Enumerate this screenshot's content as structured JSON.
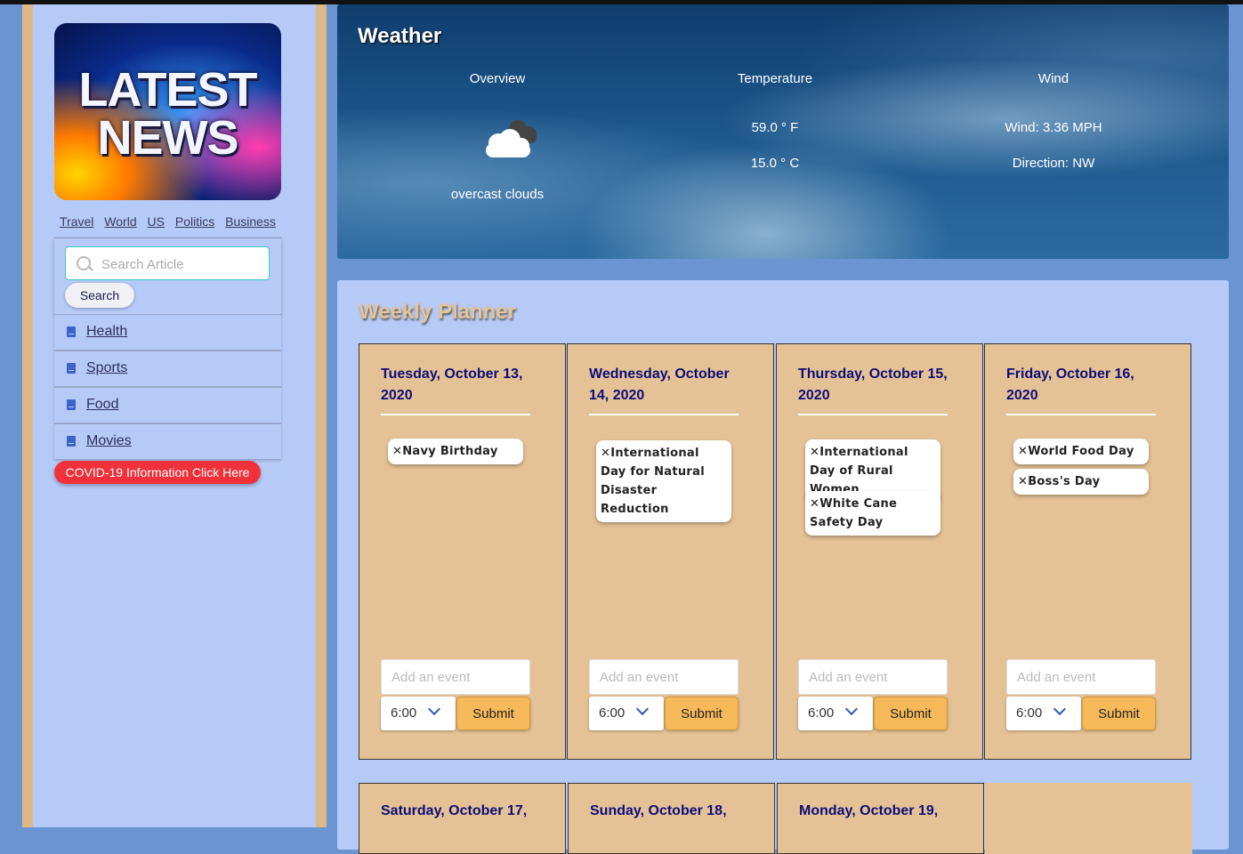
{
  "sidebar": {
    "logo_line1": "LATEST",
    "logo_line2": "NEWS",
    "nav": [
      "Travel",
      "World",
      "US",
      "Politics",
      "Business"
    ],
    "search": {
      "placeholder": "Search Article",
      "button": "Search"
    },
    "categories": [
      "Health",
      "Sports",
      "Food",
      "Movies"
    ],
    "covid_button": "COVID-19 Information Click Here"
  },
  "weather": {
    "title": "Weather",
    "overview_heading": "Overview",
    "icon": "overcast-cloud-icon",
    "description": "overcast clouds",
    "temperature_heading": "Temperature",
    "temp_f": "59.0 ° F",
    "temp_c": "15.0 ° C",
    "wind_heading": "Wind",
    "wind_speed": "Wind: 3.36 MPH",
    "wind_direction": "Direction: NW"
  },
  "planner": {
    "title": "Weekly Planner",
    "add_placeholder": "Add an event",
    "time_value": "6:00",
    "submit_label": "Submit",
    "days": [
      {
        "heading": "Tuesday, October 13, 2020",
        "events": [
          "Navy Birthday"
        ]
      },
      {
        "heading": "Wednesday, October 14, 2020",
        "events": [
          "International Day for Natural Disaster Reduction"
        ]
      },
      {
        "heading": "Thursday, October 15, 2020",
        "events": [
          "International Day of Rural Women",
          "White Cane Safety Day"
        ]
      },
      {
        "heading": "Friday, October 16, 2020",
        "events": [
          "World Food Day",
          "Boss's Day"
        ]
      }
    ],
    "next_days": [
      "Saturday, October 17,",
      "Sunday, October 18,",
      "Monday, October 19,"
    ]
  }
}
